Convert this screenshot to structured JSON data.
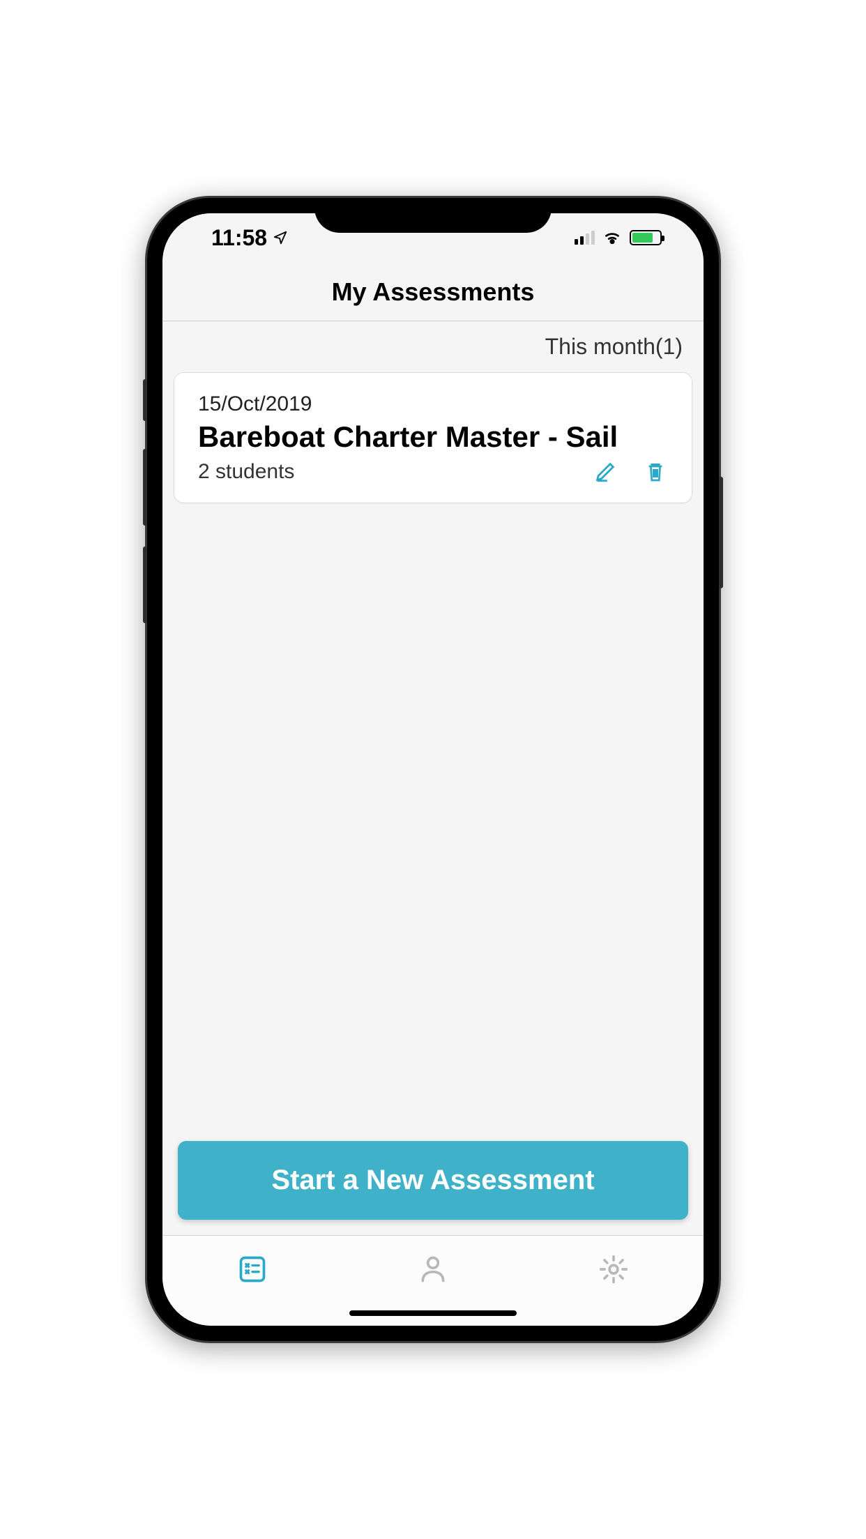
{
  "status": {
    "time": "11:58",
    "location_glyph": "➤"
  },
  "header": {
    "title": "My Assessments"
  },
  "section": {
    "label": "This month(1)"
  },
  "assessment": {
    "date": "15/Oct/2019",
    "title": "Bareboat Charter Master - Sail",
    "students": "2 students"
  },
  "actions": {
    "new_assessment": "Start a New Assessment"
  },
  "accent_color": "#3fb2c9"
}
